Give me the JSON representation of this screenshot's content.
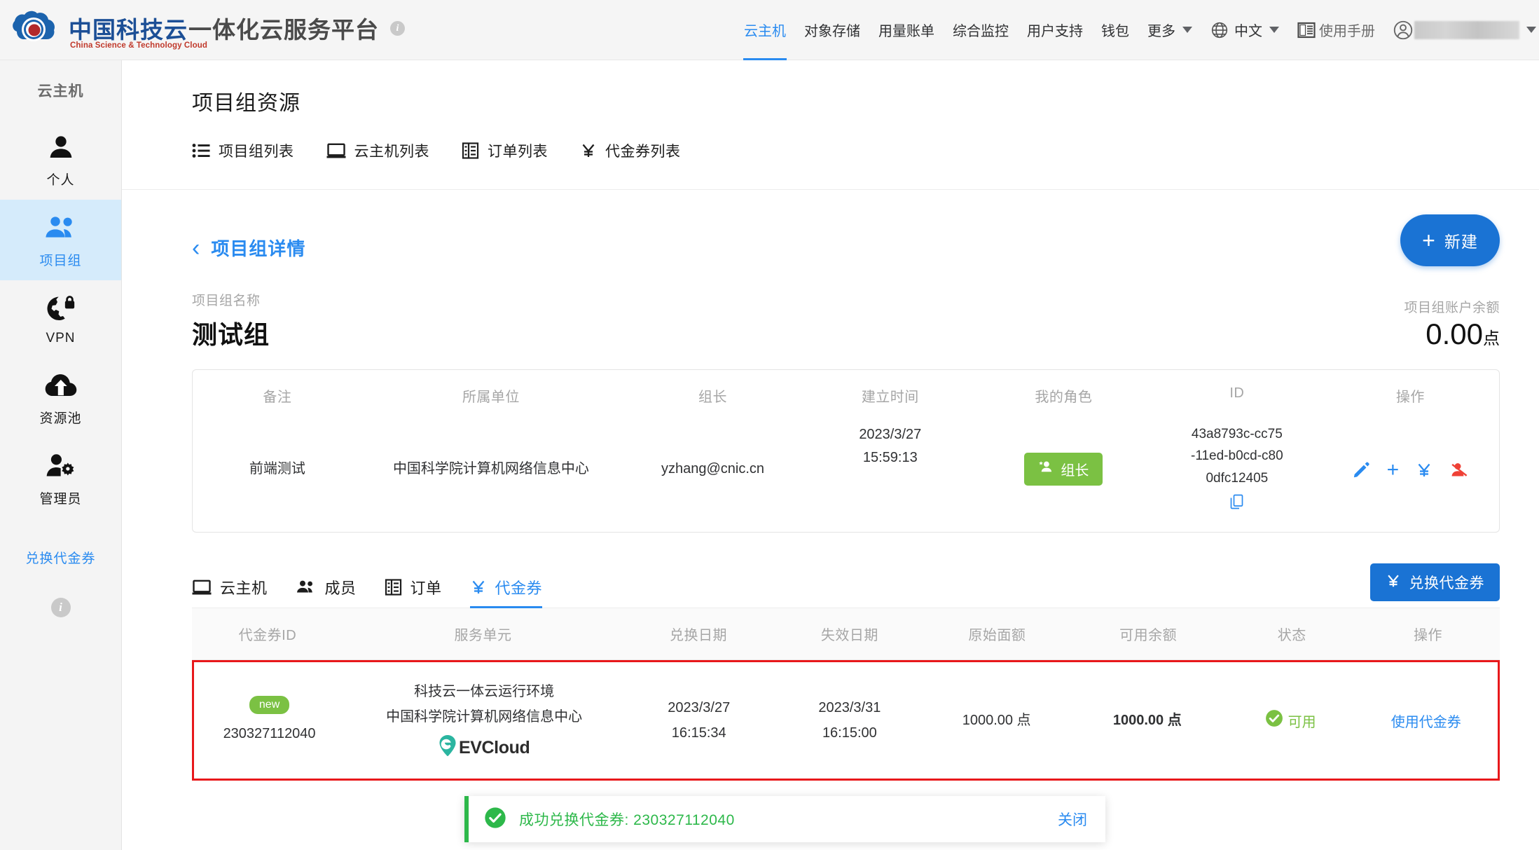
{
  "header": {
    "brand_cn": "中国科技云",
    "brand_en": "China Science & Technology Cloud",
    "brand_sub": "一体化云服务平台",
    "info_icon": "info-icon",
    "nav": [
      {
        "label": "云主机",
        "active": true
      },
      {
        "label": "对象存储",
        "active": false
      },
      {
        "label": "用量账单",
        "active": false
      },
      {
        "label": "综合监控",
        "active": false
      },
      {
        "label": "用户支持",
        "active": false
      },
      {
        "label": "钱包",
        "active": false
      },
      {
        "label": "更多",
        "active": false
      }
    ],
    "language": "中文",
    "manual": "使用手册",
    "globe_icon": "globe-icon",
    "manual_icon": "book-icon",
    "avatar_icon": "user-avatar-icon"
  },
  "sidebar": {
    "title": "云主机",
    "items": [
      {
        "label": "个人",
        "icon": "person-icon",
        "active": false
      },
      {
        "label": "项目组",
        "icon": "group-icon",
        "active": true
      },
      {
        "label": "VPN",
        "icon": "globe-lock-icon",
        "active": false
      },
      {
        "label": "资源池",
        "icon": "cloud-upload-icon",
        "active": false
      },
      {
        "label": "管理员",
        "icon": "person-gear-icon",
        "active": false
      }
    ],
    "redeem_link": "兑换代金券",
    "info_icon": "info-icon"
  },
  "page": {
    "title": "项目组资源",
    "subnav": [
      {
        "label": "项目组列表",
        "icon": "list-icon"
      },
      {
        "label": "云主机列表",
        "icon": "monitor-icon"
      },
      {
        "label": "订单列表",
        "icon": "table-icon"
      },
      {
        "label": "代金券列表",
        "icon": "yen-icon"
      }
    ],
    "new_button": "新建",
    "new_button_icon": "plus-icon"
  },
  "detail": {
    "back_label": "项目组详情",
    "back_icon": "chevron-left-icon",
    "name_label": "项目组名称",
    "name_value": "测试组",
    "balance_label": "项目组账户余额",
    "balance_value": "0.00",
    "balance_unit": "点",
    "headers": {
      "remark": "备注",
      "unit": "所属单位",
      "leader": "组长",
      "created": "建立时间",
      "role": "我的角色",
      "id": "ID",
      "actions": "操作"
    },
    "values": {
      "remark": "前端测试",
      "unit": "中国科学院计算机网络信息中心",
      "leader": "yzhang@cnic.cn",
      "created_date": "2023/3/27",
      "created_time": "15:59:13",
      "role_badge": "组长",
      "id_line1": "43a8793c-cc75",
      "id_line2": "-11ed-b0cd-c80",
      "id_line3": "0dfc12405",
      "copy_icon": "copy-icon"
    },
    "action_icons": [
      "edit-pencil-icon",
      "plus-icon",
      "yen-icon",
      "user-remove-icon"
    ]
  },
  "tabs": [
    {
      "label": "云主机",
      "icon": "monitor-icon",
      "active": false
    },
    {
      "label": "成员",
      "icon": "group-icon",
      "active": false
    },
    {
      "label": "订单",
      "icon": "table-icon",
      "active": false
    },
    {
      "label": "代金券",
      "icon": "yen-icon",
      "active": true
    }
  ],
  "redeem_button": {
    "label": "兑换代金券",
    "icon": "yen-icon"
  },
  "coupon_table": {
    "columns": [
      "代金券ID",
      "服务单元",
      "兑换日期",
      "失效日期",
      "原始面额",
      "可用余额",
      "状态",
      "操作"
    ],
    "rows": [
      {
        "badge": "new",
        "id": "230327112040",
        "service_line1": "科技云一体云运行环境",
        "service_line2": "中国科学院计算机网络信息中心",
        "service_logo": "EVCloud",
        "redeem_date": "2023/3/27",
        "redeem_time": "16:15:34",
        "expire_date": "2023/3/31",
        "expire_time": "16:15:00",
        "face_value": "1000.00 点",
        "available": "1000.00 点",
        "status": "可用",
        "status_icon": "check-circle-icon",
        "action": "使用代金券"
      }
    ]
  },
  "toast": {
    "icon": "check-circle-icon",
    "message": "成功兑换代金券: 230327112040",
    "close": "关闭"
  },
  "colors": {
    "primary_blue": "#2a8bf0",
    "button_blue": "#1a73d4",
    "green": "#7bc143",
    "toast_green": "#2db84a",
    "highlight_red": "#e8181b"
  }
}
